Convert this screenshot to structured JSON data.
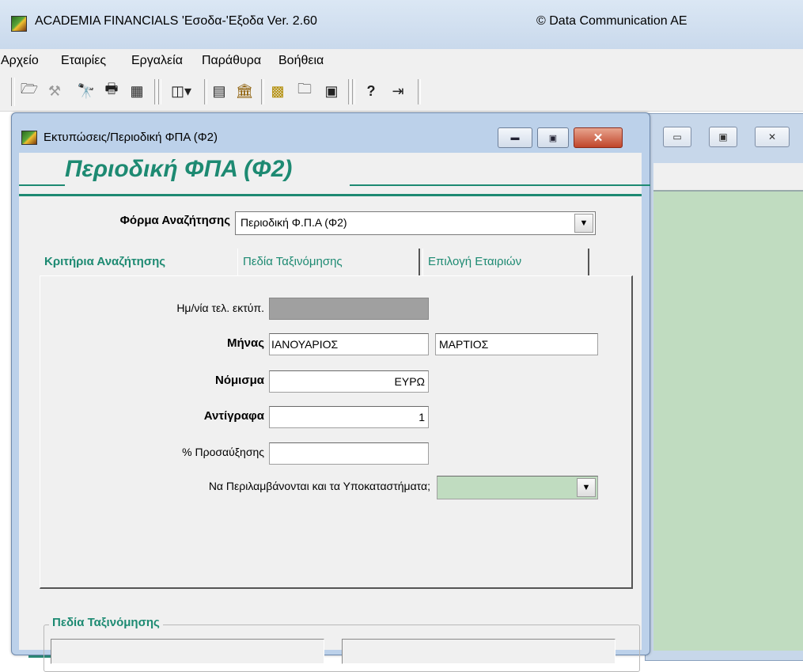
{
  "app": {
    "title": "ACADEMIA FINANCIALS 'Εσοδα-'Εξοδα Ver. 2.60",
    "copyright": "© Data Communication AE"
  },
  "menu": [
    "Αρχείο",
    "Εταιρίες",
    "Εργαλεία",
    "Παράθυρα",
    "Βοήθεια"
  ],
  "toolbar": {
    "icons": [
      "open-folder-icon",
      "tools-icon",
      "binoculars-icon",
      "printer-icon",
      "calculator-icon",
      "columns-dropdown-icon",
      "report-icon",
      "bank-icon",
      "chart-icon",
      "folder-icon",
      "monitor-icon",
      "help-icon",
      "exit-door-icon"
    ],
    "glyphs": [
      "🗁",
      "⚒",
      "🔭",
      "🖶",
      "▦",
      "◫▾",
      "▤",
      "🏛",
      "▩",
      "🗀",
      "▣",
      "?",
      "⇥"
    ]
  },
  "dialog": {
    "title": "Εκτυπώσεις/Περιοδική ΦΠΑ (Φ2)",
    "heading": "Περιοδική ΦΠΑ (Φ2)",
    "search_form_label": "Φόρμα Αναζήτησης",
    "search_form_value": "Περιοδική Φ.Π.Α (Φ2)",
    "tabs": [
      "Κριτήρια Αναζήτησης",
      "Πεδία Ταξινόμησης",
      "Επιλογή Εταιριών"
    ],
    "fields": {
      "print_date_label": "Ημ/νία τελ. εκτύπ.",
      "month_label": "Μήνας",
      "month_from": "ΙΑΝΟΥΑΡΙΟΣ",
      "month_to": "ΜΑΡΤΙΟΣ",
      "currency_label": "Νόμισμα",
      "currency_value": "ΕΥΡΩ",
      "copies_label": "Αντίγραφα",
      "copies_value": "1",
      "surcharge_label": "% Προσαύξησης",
      "branches_label": "Να Περιλαμβάνονται και τα Υποκαταστήματα;"
    },
    "sort_group_title": "Πεδία Ταξινόμησης"
  },
  "colors": {
    "accent": "#1d8a72",
    "panel": "#f0f0f0",
    "green_field": "#c0dcc0"
  }
}
